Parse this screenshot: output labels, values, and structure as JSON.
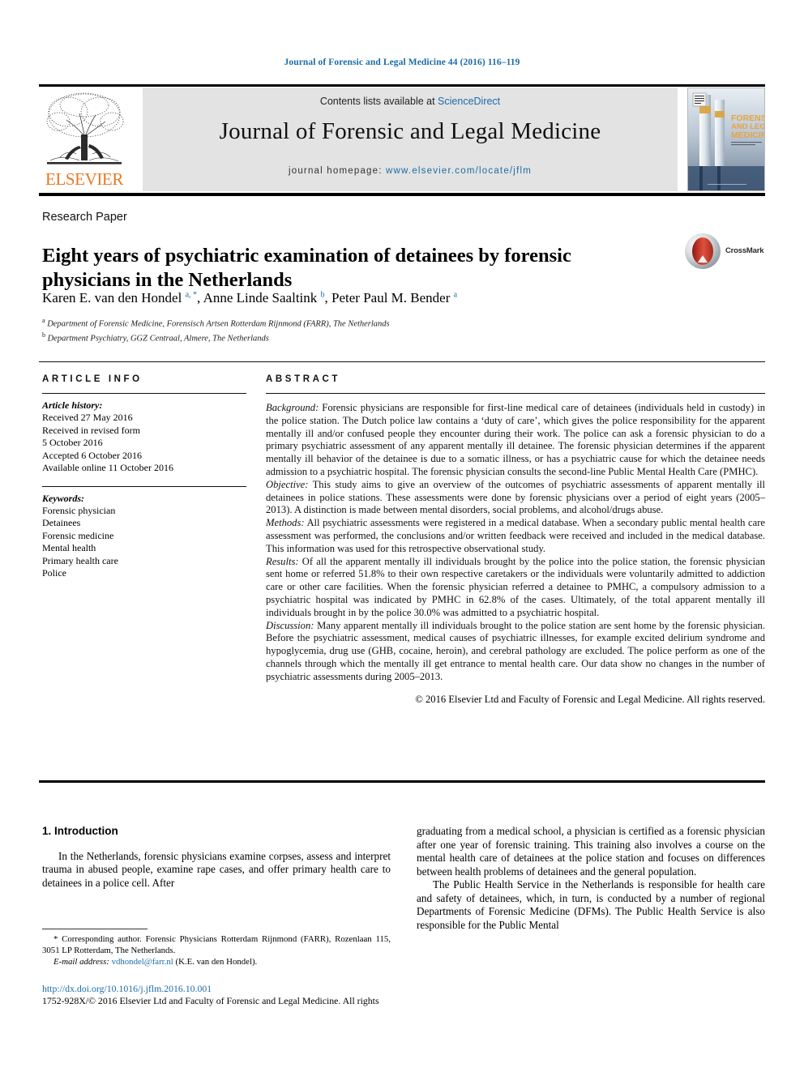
{
  "running_head": "Journal of Forensic and Legal Medicine 44 (2016) 116–119",
  "masthead": {
    "publisher_name": "ELSEVIER",
    "contents_prefix": "Contents lists available at ",
    "contents_link": "ScienceDirect",
    "journal_name": "Journal of Forensic and Legal Medicine",
    "homepage_prefix": "journal homepage: ",
    "homepage_link": "www.elsevier.com/locate/jflm",
    "cover_title_line1": "FORENSIC",
    "cover_title_line2": "AND LEGAL",
    "cover_title_line3": "MEDICINE"
  },
  "article": {
    "type": "Research Paper",
    "title": "Eight years of psychiatric examination of detainees by forensic physicians in the Netherlands",
    "crossmark_label": "CrossMark",
    "authors_html": "Karen E. van den Hondel <sup>a, *</sup>, Anne Linde Saaltink <sup>b</sup>, Peter Paul M. Bender <sup>a</sup>",
    "affiliation_a": "Department of Forensic Medicine, Forensisch Artsen Rotterdam Rijnmond (FARR), The Netherlands",
    "affiliation_b": "Department Psychiatry, GGZ Centraal, Almere, The Netherlands"
  },
  "article_info": {
    "heading": "ARTICLE INFO",
    "history_label": "Article history:",
    "history": [
      "Received 27 May 2016",
      "Received in revised form",
      "5 October 2016",
      "Accepted 6 October 2016",
      "Available online 11 October 2016"
    ],
    "keywords_label": "Keywords:",
    "keywords": [
      "Forensic physician",
      "Detainees",
      "Forensic medicine",
      "Mental health",
      "Primary health care",
      "Police"
    ]
  },
  "abstract": {
    "heading": "ABSTRACT",
    "sections": [
      {
        "label": "Background:",
        "text": " Forensic physicians are responsible for first-line medical care of detainees (individuals held in custody) in the police station. The Dutch police law contains a ‘duty of care’, which gives the police responsibility for the apparent mentally ill and/or confused people they encounter during their work. The police can ask a forensic physician to do a primary psychiatric assessment of any apparent mentally ill detainee. The forensic physician determines if the apparent mentally ill behavior of the detainee is due to a somatic illness, or has a psychiatric cause for which the detainee needs admission to a psychiatric hospital. The forensic physician consults the second-line Public Mental Health Care (PMHC)."
      },
      {
        "label": "Objective:",
        "text": " This study aims to give an overview of the outcomes of psychiatric assessments of apparent mentally ill detainees in police stations. These assessments were done by forensic physicians over a period of eight years (2005–2013). A distinction is made between mental disorders, social problems, and alcohol/drugs abuse."
      },
      {
        "label": "Methods:",
        "text": " All psychiatric assessments were registered in a medical database. When a secondary public mental health care assessment was performed, the conclusions and/or written feedback were received and included in the medical database. This information was used for this retrospective observational study."
      },
      {
        "label": "Results:",
        "text": " Of all the apparent mentally ill individuals brought by the police into the police station, the forensic physician sent home or referred 51.8% to their own respective caretakers or the individuals were voluntarily admitted to addiction care or other care facilities. When the forensic physician referred a detainee to PMHC, a compulsory admission to a psychiatric hospital was indicated by PMHC in 62.8% of the cases. Ultimately, of the total apparent mentally ill individuals brought in by the police 30.0% was admitted to a psychiatric hospital."
      },
      {
        "label": "Discussion:",
        "text": " Many apparent mentally ill individuals brought to the police station are sent home by the forensic physician. Before the psychiatric assessment, medical causes of psychiatric illnesses, for example excited delirium syndrome and hypoglycemia, drug use (GHB, cocaine, heroin), and cerebral pathology are excluded. The police perform as one of the channels through which the mentally ill get entrance to mental health care. Our data show no changes in the number of psychiatric assessments during 2005–2013."
      }
    ],
    "copyright": "© 2016 Elsevier Ltd and Faculty of Forensic and Legal Medicine. All rights reserved."
  },
  "introduction": {
    "heading": "1. Introduction",
    "left_para1": "In the Netherlands, forensic physicians examine corpses, assess and interpret trauma in abused people, examine rape cases, and offer primary health care to detainees in a police cell. After",
    "right_para1": "graduating from a medical school, a physician is certified as a forensic physician after one year of forensic training. This training also involves a course on the mental health care of detainees at the police station and focuses on differences between health problems of detainees and the general population.",
    "right_para2": "The Public Health Service in the Netherlands is responsible for health care and safety of detainees, which, in turn, is conducted by a number of regional Departments of Forensic Medicine (DFMs). The Public Health Service is also responsible for the Public Mental"
  },
  "footnotes": {
    "corresponding": "* Corresponding author. Forensic Physicians Rotterdam Rijnmond (FARR), Rozenlaan 115, 3051 LP Rotterdam, The Netherlands.",
    "email_label": "E-mail address:",
    "email": "vdhondel@farr.nl",
    "email_suffix": " (K.E. van den Hondel).",
    "doi": "http://dx.doi.org/10.1016/j.jflm.2016.10.001",
    "issn_line": "1752-928X/© 2016 Elsevier Ltd and Faculty of Forensic and Legal Medicine. All rights"
  },
  "colors": {
    "link_blue": "#1a6ca8",
    "elsevier_orange": "#E87722",
    "band_grey": "#e3e3e3",
    "crossmark_red": "#c0392b"
  }
}
